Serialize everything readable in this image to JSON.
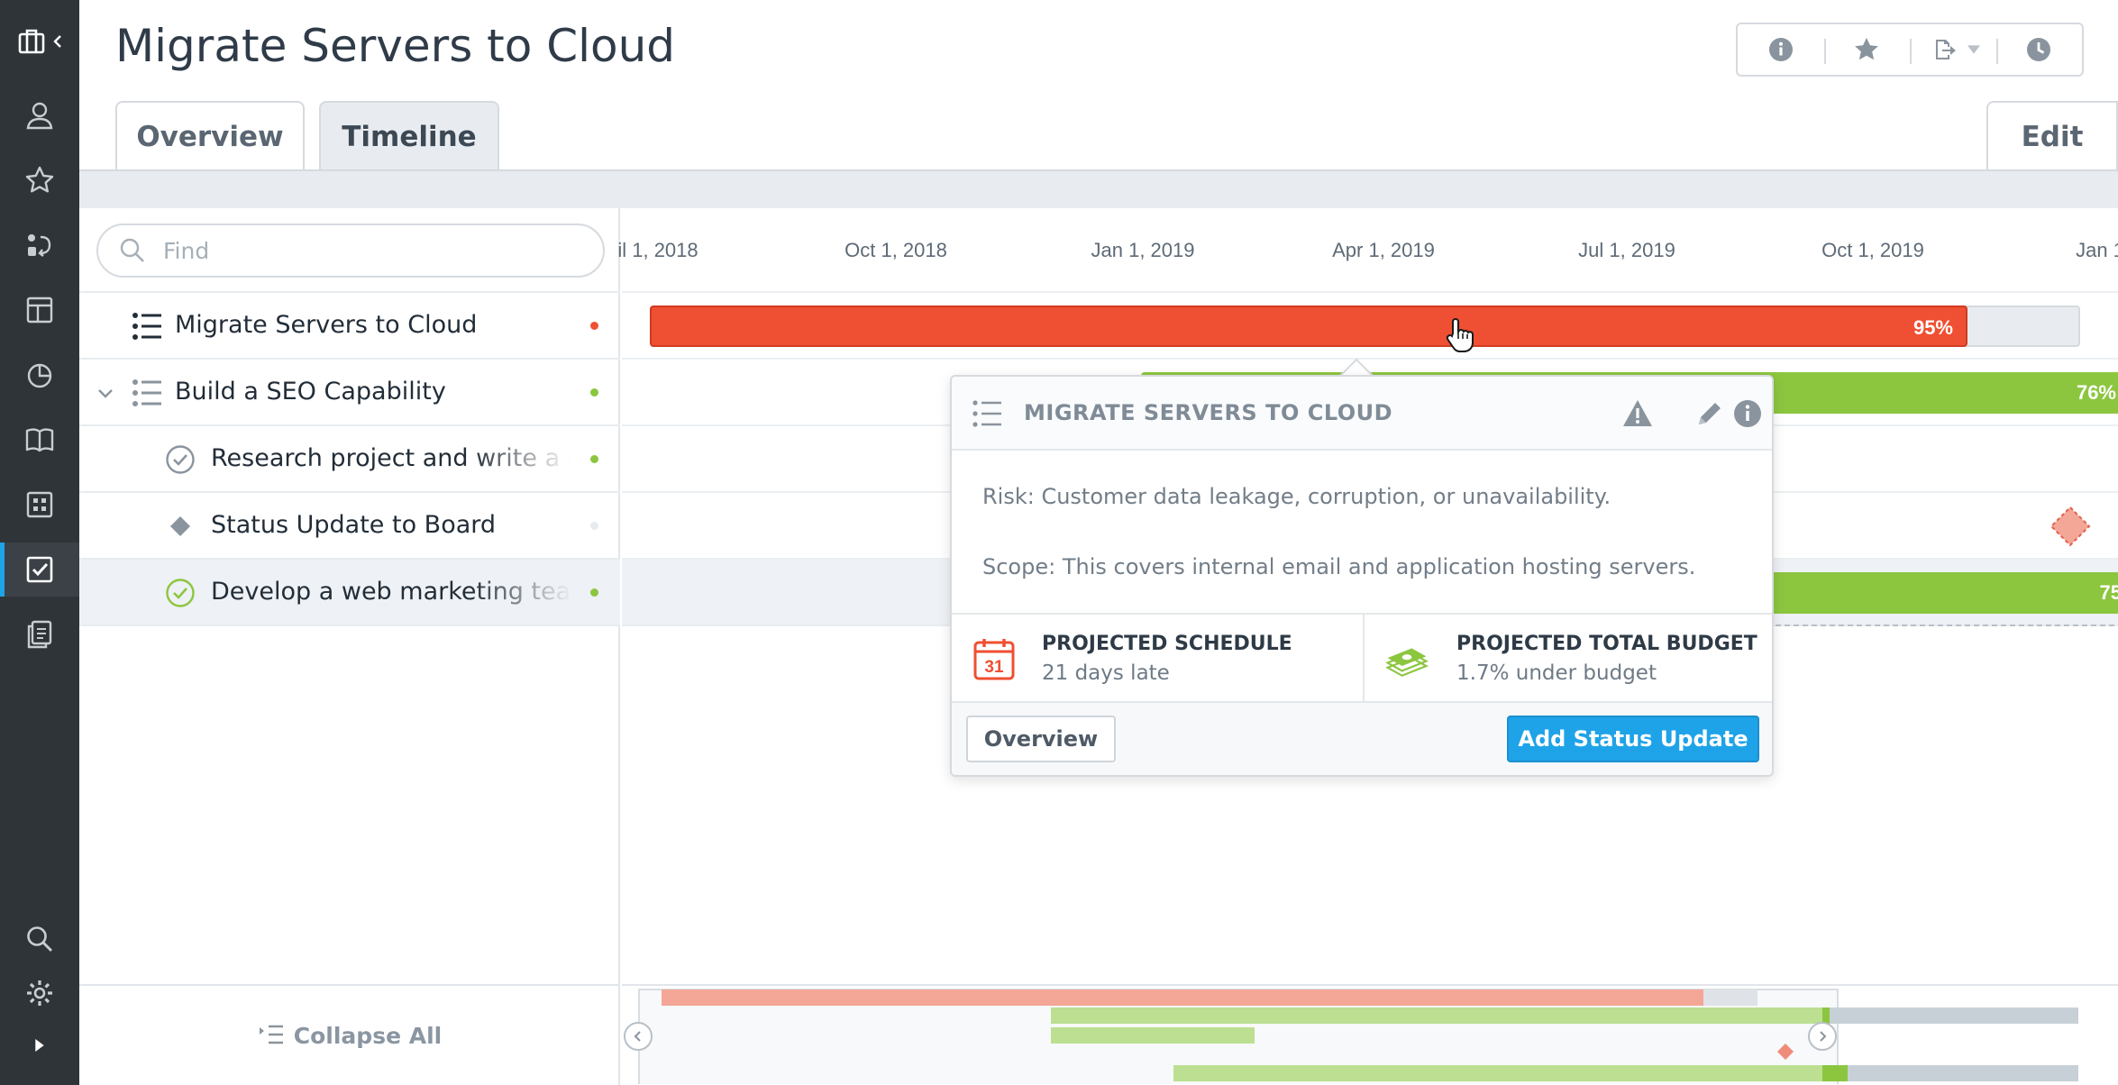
{
  "app": {
    "page_title": "Migrate Servers to Cloud",
    "tabs": [
      {
        "label": "Overview",
        "active": false
      },
      {
        "label": "Timeline",
        "active": true
      }
    ],
    "edit_label": "Edit",
    "header_actions": [
      "info-icon",
      "star-icon",
      "export-icon",
      "history-icon"
    ]
  },
  "rail": {
    "items": [
      "portfolio-icon",
      "user-icon",
      "star-icon",
      "workflow-icon",
      "dashboard-icon",
      "chart-icon",
      "library-icon",
      "grid-icon",
      "tasks-icon",
      "documents-icon",
      "search-icon",
      "settings-icon",
      "expand-icon"
    ],
    "active": "tasks-icon",
    "accent": "#1fa3e8"
  },
  "tree": {
    "find_placeholder": "Find",
    "rows": [
      {
        "label": "Migrate Servers to Cloud",
        "icon": "list-icon",
        "status_color": "#ef4f32"
      },
      {
        "label": "Build a SEO Capability",
        "icon": "list-icon",
        "status_color": "#8cc63f"
      },
      {
        "label": "Research project and write a r",
        "icon": "check-circle-icon",
        "status_color": "#8cc63f"
      },
      {
        "label": "Status Update to Board",
        "icon": "diamond-icon",
        "status_color": "#e8ebee"
      },
      {
        "label": "Develop a web marketing team",
        "icon": "check-circle-icon",
        "status_color": "#8cc63f"
      }
    ],
    "collapse_label": "Collapse All"
  },
  "timeline": {
    "ticks": [
      "il 1, 2018",
      "Oct 1, 2018",
      "Jan 1, 2019",
      "Apr 1, 2019",
      "Jul 1, 2019",
      "Oct 1, 2019",
      "Jan 1"
    ],
    "bars": [
      {
        "row": 0,
        "label": "95%",
        "color": "#ef4f32"
      },
      {
        "row": 1,
        "label": "76%",
        "color": "#8cc63f"
      },
      {
        "row": 4,
        "label": "75",
        "color": "#8cc63f"
      }
    ]
  },
  "popover": {
    "title": "MIGRATE SERVERS TO CLOUD",
    "risk": "Risk: Customer data leakage, corruption, or unavailability.",
    "scope": "Scope: This covers internal email and application hosting servers.",
    "schedule_title": "PROJECTED SCHEDULE",
    "schedule_value": "21 days late",
    "calendar_day": "31",
    "budget_title": "PROJECTED TOTAL BUDGET",
    "budget_value": "1.7% under budget",
    "overview_button": "Overview",
    "status_button": "Add Status Update"
  }
}
